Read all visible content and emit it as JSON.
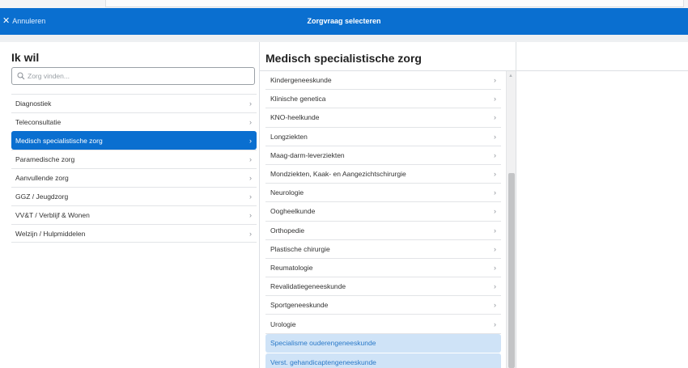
{
  "header": {
    "cancel_label": "Annuleren",
    "title": "Zorgvraag selecteren"
  },
  "left": {
    "heading": "Ik wil",
    "search_placeholder": "Zorg vinden...",
    "items": [
      {
        "label": "Diagnostiek"
      },
      {
        "label": "Teleconsultatie"
      },
      {
        "label": "Medisch specialistische zorg",
        "selected": true
      },
      {
        "label": "Paramedische zorg"
      },
      {
        "label": "Aanvullende zorg"
      },
      {
        "label": "GGZ / Jeugdzorg"
      },
      {
        "label": "VV&T / Verblijf & Wonen"
      },
      {
        "label": "Welzijn / Hulpmiddelen"
      }
    ]
  },
  "middle": {
    "heading": "Medisch specialistische zorg",
    "items": [
      {
        "label": "Kindergeneeskunde"
      },
      {
        "label": "Klinische genetica"
      },
      {
        "label": "KNO-heelkunde"
      },
      {
        "label": "Longziekten"
      },
      {
        "label": "Maag-darm-leverziekten"
      },
      {
        "label": "Mondziekten, Kaak- en Aangezichtschirurgie"
      },
      {
        "label": "Neurologie"
      },
      {
        "label": "Oogheelkunde"
      },
      {
        "label": "Orthopedie"
      },
      {
        "label": "Plastische chirurgie"
      },
      {
        "label": "Reumatologie"
      },
      {
        "label": "Revalidatiegeneeskunde"
      },
      {
        "label": "Sportgeneeskunde"
      },
      {
        "label": "Urologie"
      },
      {
        "label": "Specialisme ouderengeneeskunde",
        "highlight": true
      },
      {
        "label": "Verst. gehandicaptengeneeskunde",
        "highlight": true
      }
    ]
  },
  "colors": {
    "primary": "#0a6fd0",
    "highlight_bg": "#cfe3f7",
    "highlight_text": "#2a79c8"
  },
  "icons": {
    "cancel": "close-icon",
    "search": "search-icon",
    "row": "chevron-right-icon"
  }
}
